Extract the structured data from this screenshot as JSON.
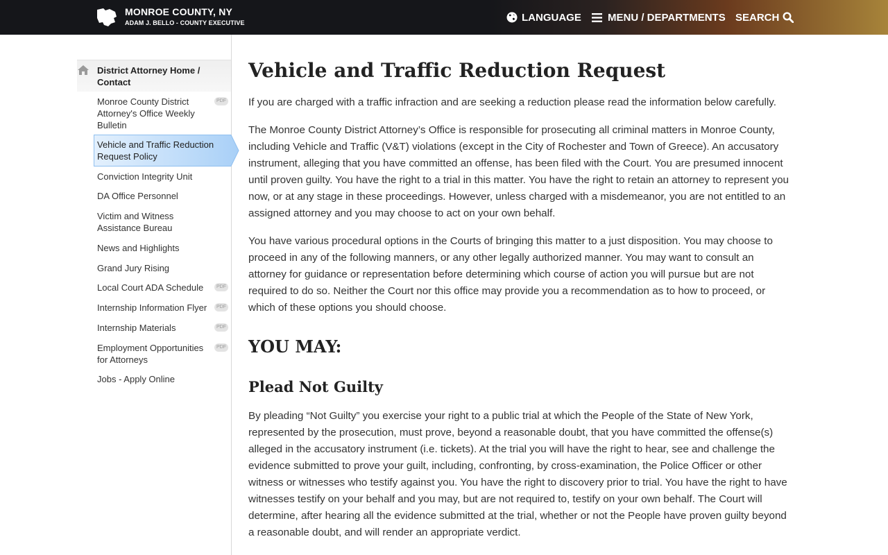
{
  "header": {
    "title": "MONROE COUNTY, NY",
    "subtitle": "ADAM J. BELLO - COUNTY EXECUTIVE",
    "nav": {
      "language": "LANGUAGE",
      "menu": "MENU / DEPARTMENTS",
      "search": "SEARCH"
    }
  },
  "sidebar": {
    "home": "District Attorney Home / Contact",
    "pdf_badge": "PDF",
    "items": [
      {
        "label": "Monroe County District Attorney's Office Weekly Bulletin",
        "pdf": true
      },
      {
        "label": "Vehicle and Traffic Reduction Request Policy",
        "active": true
      },
      {
        "label": "Conviction Integrity Unit"
      },
      {
        "label": "DA Office Personnel"
      },
      {
        "label": "Victim and Witness Assistance Bureau"
      },
      {
        "label": "News and Highlights"
      },
      {
        "label": "Grand Jury Rising"
      },
      {
        "label": "Local Court ADA Schedule",
        "pdf": true
      },
      {
        "label": "Internship Information Flyer",
        "pdf": true
      },
      {
        "label": "Internship Materials",
        "pdf": true
      },
      {
        "label": "Employment Opportunities for Attorneys",
        "pdf": true
      },
      {
        "label": "Jobs - Apply Online"
      }
    ]
  },
  "main": {
    "title": "Vehicle and Traffic Reduction Request",
    "intro": "If you are charged with a traffic infraction and are seeking a reduction please read the information below carefully.",
    "para1": "The Monroe County District Attorney’s Office is responsible for prosecuting all criminal matters in Monroe County, including Vehicle and Traffic (V&T) violations (except in the City of Rochester and Town of Greece). An accusatory instrument, alleging that you have committed an offense, has been filed with the Court. You are presumed innocent until proven guilty. You have the right to a trial in this matter. You have the right to retain an attorney to represent you now, or at any stage in these proceedings. However, unless charged with a misdemeanor, you are not entitled to an assigned attorney and you may choose to act on your own behalf.",
    "para2": "You have various procedural options in the Courts of bringing this matter to a just disposition. You may choose to proceed in any of the following manners, or any other legally authorized manner. You may want to consult an attorney for guidance or representation before determining which course of action you will pursue but are not required to do so. Neither the Court nor this office may provide you a recommendation as to how to proceed, or which of these options you should choose.",
    "heading_may": "YOU MAY:",
    "heading_plead": "Plead Not Guilty",
    "para3": "By pleading “Not Guilty” you exercise your right to a public trial at which the People of the State of New York, represented by the prosecution, must prove, beyond a reasonable doubt, that you have committed the offense(s) alleged in the accusatory instrument (i.e. tickets). At the trial you will have the right to hear, see and challenge the evidence submitted to prove your guilt, including, confronting, by cross-examination, the Police Officer or other witness or witnesses who testify against you. You have the right to discovery prior to trial. You have the right to have witnesses testify on your behalf and you may, but are not required to, testify on your own behalf. The Court will determine, after hearing all the evidence submitted at the trial, whether or not the People have proven guilty beyond a reasonable doubt, and will render an appropriate verdict."
  }
}
